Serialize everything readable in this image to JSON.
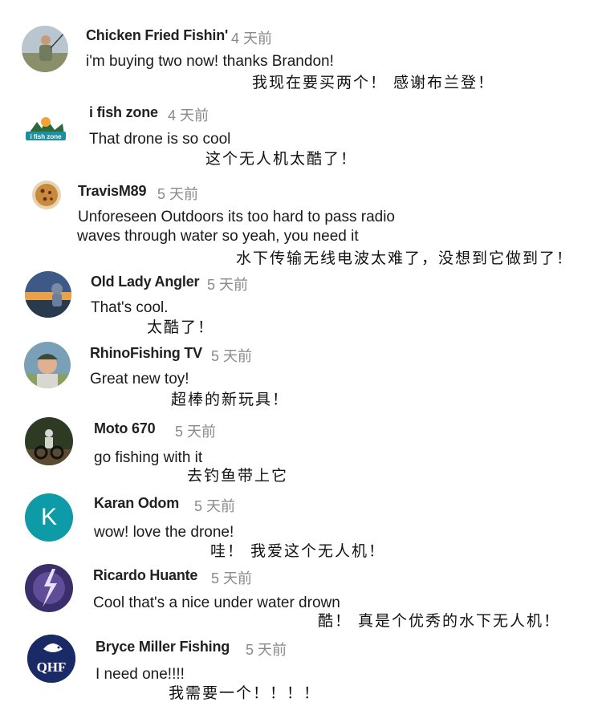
{
  "comments": [
    {
      "author": "Chicken Fried Fishin'",
      "time": "4 天前",
      "text": "i'm buying two now!  thanks Brandon!",
      "translation": "我现在要买两个！ 感谢布兰登！",
      "avatar_icon": "fishing-person-photo"
    },
    {
      "author": "i fish zone",
      "time": "4 天前",
      "text": "That drone is so cool",
      "translation": "这个无人机太酷了！",
      "avatar_icon": "i-fish-zone-logo",
      "avatar_logo_text": "i fish zone"
    },
    {
      "author": "TravisM89",
      "time": "5 天前",
      "text_line1": "Unforeseen Outdoors its too hard to pass radio",
      "text_line2": "waves through water so yeah, you need  it",
      "translation": "水下传输无线电波太难了，没想到它做到了！",
      "avatar_icon": "cookie-photo"
    },
    {
      "author": "Old Lady Angler",
      "time": "5 天前",
      "text": "That's cool.",
      "translation": "太酷了！",
      "avatar_icon": "sunset-fishing-photo"
    },
    {
      "author": "RhinoFishing TV",
      "time": "5 天前",
      "text": "Great new toy!",
      "translation": "超棒的新玩具！",
      "avatar_icon": "man-with-cap-photo"
    },
    {
      "author": "Moto 670",
      "time": "5 天前",
      "text": "go fishing with it",
      "translation": "去钓鱼带上它",
      "avatar_icon": "motocross-photo"
    },
    {
      "author": "Karan Odom",
      "time": "5 天前",
      "text": "wow!  love the drone!",
      "translation": "哇！ 我爱这个无人机！",
      "avatar_letter": "K",
      "avatar_color": "#0f9aa7"
    },
    {
      "author": "Ricardo Huante",
      "time": "5 天前",
      "text": "Cool that's a nice  under water drown",
      "translation": "酷！ 真是个优秀的水下无人机！",
      "avatar_icon": "lightning-storm-photo"
    },
    {
      "author": "Bryce Miller Fishing",
      "time": "5 天前",
      "text": "I need one!!!!",
      "translation": "我需要一个！！！！",
      "avatar_icon": "qhf-fish-logo",
      "avatar_logo_text": "QHF"
    }
  ]
}
